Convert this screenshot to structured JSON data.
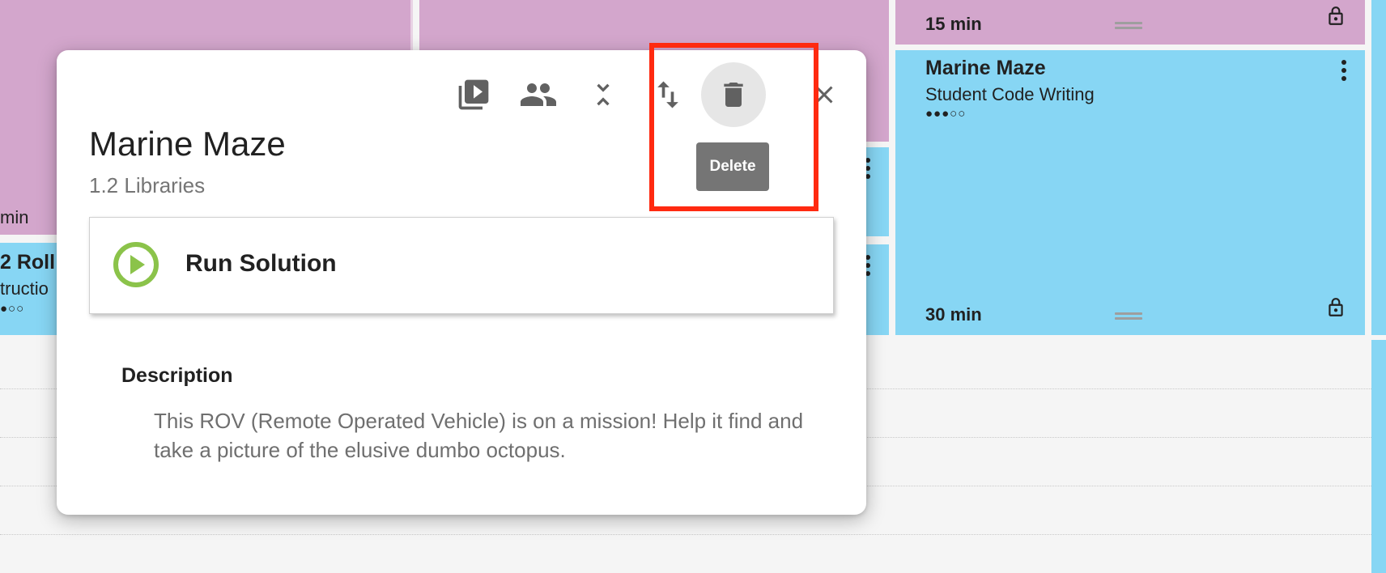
{
  "background": {
    "left_blocks": {
      "top_duration": "min",
      "second_title": "2 Roll",
      "second_subtitle": "tructio",
      "second_dots": "●○○"
    },
    "right_column": {
      "top_card_duration": "15 min",
      "card": {
        "title": "Marine Maze",
        "subtitle": "Student Code Writing",
        "difficulty_dots": "●●●○○",
        "duration": "30 min"
      }
    },
    "colors": {
      "pink_block": "#d3a6cc",
      "blue_block": "#87d6f4"
    }
  },
  "modal": {
    "toolbar": {
      "icons": [
        "video-library-icon",
        "people-icon",
        "collapse-icon",
        "swap-vert-icon",
        "delete-icon",
        "close-icon"
      ],
      "delete_tooltip": "Delete"
    },
    "title": "Marine Maze",
    "subtitle": "1.2 Libraries",
    "run_solution_label": "Run Solution",
    "description_heading": "Description",
    "description_text": "This ROV (Remote Operated Vehicle) is on a mission! Help it find and take a picture of the elusive dumbo octopus.",
    "colors": {
      "play_icon": "#8bc34a",
      "highlight_box": "#ff2a10",
      "tooltip_bg": "#757575"
    }
  }
}
